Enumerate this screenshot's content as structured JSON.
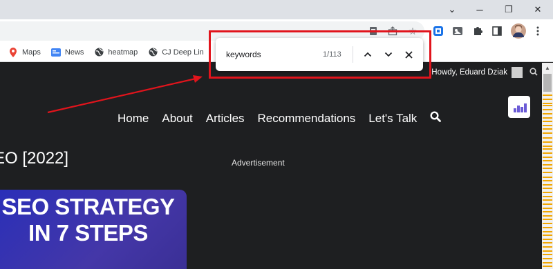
{
  "window_controls": {
    "chevron": "⌄",
    "minimize": "─",
    "restore": "❐",
    "close": "✕"
  },
  "toolbar_icons": [
    "page-action-icon",
    "share-icon",
    "star-icon",
    "extension-blue-icon",
    "extension-image-icon",
    "puzzle-icon",
    "side-panel-icon",
    "profile-avatar-icon",
    "menu-icon"
  ],
  "bookmarks": [
    {
      "label": "Maps",
      "icon": "maps-pin-icon",
      "color": "#ea4335"
    },
    {
      "label": "News",
      "icon": "news-icon",
      "color": "#4285f4"
    },
    {
      "label": "heatmap",
      "icon": "globe-icon",
      "color": "#3c4043"
    },
    {
      "label": "CJ Deep Lin",
      "icon": "globe-icon",
      "color": "#3c4043"
    }
  ],
  "find_bar": {
    "query": "keywords",
    "count": "1/113"
  },
  "admin_bar": {
    "greeting": "Howdy, Eduard Dziak"
  },
  "nav": {
    "items": [
      "Home",
      "About",
      "Articles",
      "Recommendations",
      "Let's Talk"
    ]
  },
  "page": {
    "title_fragment": "EO [2022]",
    "advertisement": "Advertisement",
    "thumbnail_line1": "SEO STRATEGY",
    "thumbnail_line2": "IN 7 STEPS"
  },
  "colors": {
    "highlight": "#e1141c",
    "page_bg": "#1e1f21",
    "thumb": "#3a33b0"
  }
}
